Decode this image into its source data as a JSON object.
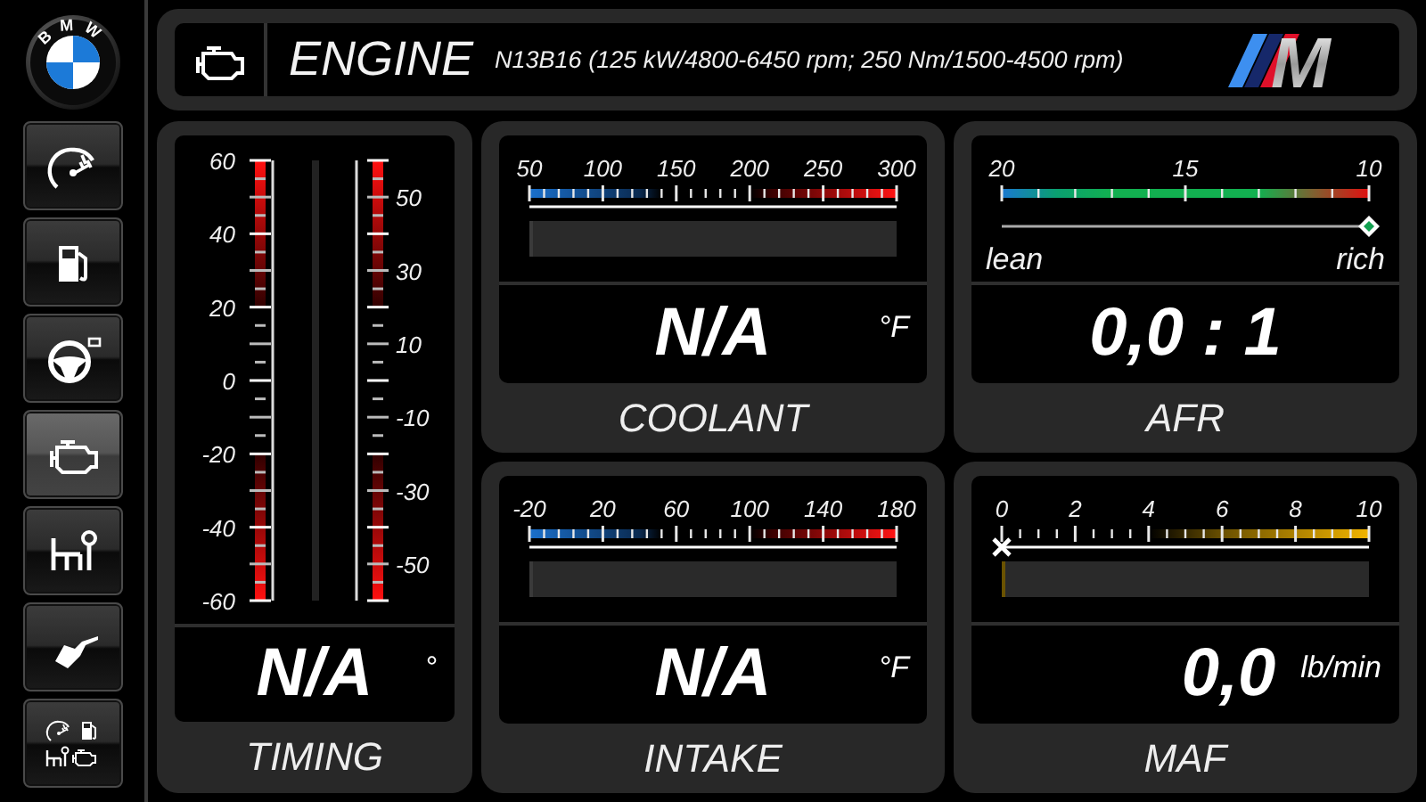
{
  "sidebar": {
    "logo_text": "BMW",
    "items": [
      {
        "kind": "gauge",
        "selected": false
      },
      {
        "kind": "fuel",
        "selected": false
      },
      {
        "kind": "steering",
        "selected": false
      },
      {
        "kind": "engine",
        "selected": true
      },
      {
        "kind": "gearshift",
        "selected": false
      },
      {
        "kind": "nozzle",
        "selected": false
      },
      {
        "kind": "overview",
        "selected": false
      }
    ]
  },
  "header": {
    "title": "ENGINE",
    "subtitle": "N13B16 (125 kW/4800-6450 rpm; 250 Nm/1500-4500 rpm)",
    "logo_text": "M"
  },
  "timing": {
    "left_scale": [
      "60",
      "40",
      "20",
      "0",
      "-20",
      "-40",
      "-60"
    ],
    "right_scale": [
      "50",
      "30",
      "10",
      "-10",
      "-30",
      "-50"
    ],
    "value": "N/A",
    "unit": "°",
    "label": "TIMING"
  },
  "gauges": [
    {
      "kind": "temp",
      "scale": [
        "50",
        "100",
        "150",
        "200",
        "250",
        "300"
      ],
      "level": 0,
      "value": "N/A",
      "unit": "°F",
      "label": "COOLANT"
    },
    {
      "kind": "afr",
      "scale": [
        "20",
        "15",
        "10"
      ],
      "ends": [
        "lean",
        "rich"
      ],
      "level": 1,
      "value": "0,0 : 1",
      "label": "AFR"
    },
    {
      "kind": "temp",
      "scale": [
        "-20",
        "20",
        "60",
        "100",
        "140",
        "180"
      ],
      "level": 0,
      "value": "N/A",
      "unit": "°F",
      "label": "INTAKE"
    },
    {
      "kind": "flow",
      "scale": [
        "0",
        "2",
        "4",
        "6",
        "8",
        "10"
      ],
      "level": 0,
      "value": "0,0",
      "unit": "lb/min",
      "label": "MAF"
    }
  ]
}
